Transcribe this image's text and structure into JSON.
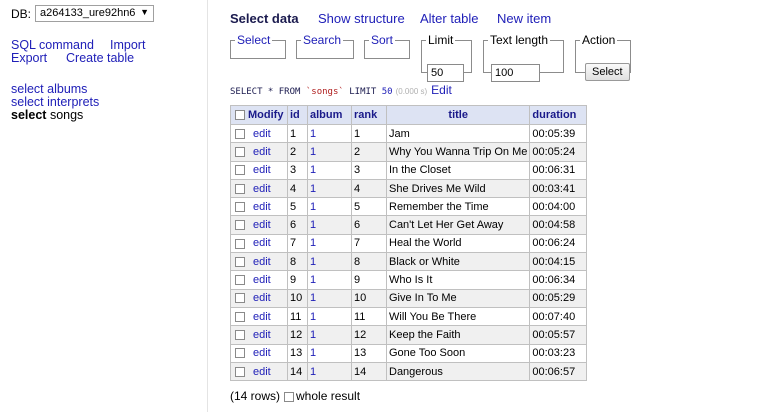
{
  "menu": {
    "db_label": "DB:",
    "db_value": "a264133_ure92hn6",
    "links": {
      "sql_command": "SQL command",
      "import": "Import",
      "export": "Export",
      "create_table": "Create table"
    },
    "tables": [
      {
        "action": "select",
        "name": "albums",
        "active": false
      },
      {
        "action": "select",
        "name": "interprets",
        "active": false
      },
      {
        "action": "select",
        "name": "songs",
        "active": true
      }
    ]
  },
  "tabs": {
    "select_data": "Select data",
    "show_structure": "Show structure",
    "alter_table": "Alter table",
    "new_item": "New item"
  },
  "controls": {
    "select_legend": "Select",
    "search_legend": "Search",
    "sort_legend": "Sort",
    "limit_legend": "Limit",
    "limit_value": "50",
    "text_length_legend": "Text length",
    "text_length_value": "100",
    "action_legend": "Action",
    "action_button": "Select"
  },
  "query": {
    "select_kw": "SELECT * FROM",
    "table_str": "`songs`",
    "limit_kw": "LIMIT",
    "limit_num": "50",
    "time": "(0.000 s)",
    "edit_label": "Edit"
  },
  "table": {
    "columns": [
      "Modify",
      "id",
      "album",
      "rank",
      "title",
      "duration"
    ],
    "edit_label": "edit",
    "rows": [
      {
        "id": "1",
        "album": "1",
        "rank": "1",
        "title": "Jam",
        "duration": "00:05:39"
      },
      {
        "id": "2",
        "album": "1",
        "rank": "2",
        "title": "Why You Wanna Trip On Me",
        "duration": "00:05:24"
      },
      {
        "id": "3",
        "album": "1",
        "rank": "3",
        "title": "In the Closet",
        "duration": "00:06:31"
      },
      {
        "id": "4",
        "album": "1",
        "rank": "4",
        "title": "She Drives Me Wild",
        "duration": "00:03:41"
      },
      {
        "id": "5",
        "album": "1",
        "rank": "5",
        "title": "Remember the Time",
        "duration": "00:04:00"
      },
      {
        "id": "6",
        "album": "1",
        "rank": "6",
        "title": "Can't Let Her Get Away",
        "duration": "00:04:58"
      },
      {
        "id": "7",
        "album": "1",
        "rank": "7",
        "title": "Heal the World",
        "duration": "00:06:24"
      },
      {
        "id": "8",
        "album": "1",
        "rank": "8",
        "title": "Black or White",
        "duration": "00:04:15"
      },
      {
        "id": "9",
        "album": "1",
        "rank": "9",
        "title": "Who Is It",
        "duration": "00:06:34"
      },
      {
        "id": "10",
        "album": "1",
        "rank": "10",
        "title": "Give In To Me",
        "duration": "00:05:29"
      },
      {
        "id": "11",
        "album": "1",
        "rank": "11",
        "title": "Will You Be There",
        "duration": "00:07:40"
      },
      {
        "id": "12",
        "album": "1",
        "rank": "12",
        "title": "Keep the Faith",
        "duration": "00:05:57"
      },
      {
        "id": "13",
        "album": "1",
        "rank": "13",
        "title": "Gone Too Soon",
        "duration": "00:03:23"
      },
      {
        "id": "14",
        "album": "1",
        "rank": "14",
        "title": "Dangerous",
        "duration": "00:06:57"
      }
    ]
  },
  "footer": {
    "rows_count": "(14 rows)",
    "whole_result": "whole result"
  },
  "colors": {
    "link": "#2020b8",
    "header_bg": "#dde3f3",
    "header_text": "#1a1a8a",
    "zebra": "#f0f0f0"
  }
}
